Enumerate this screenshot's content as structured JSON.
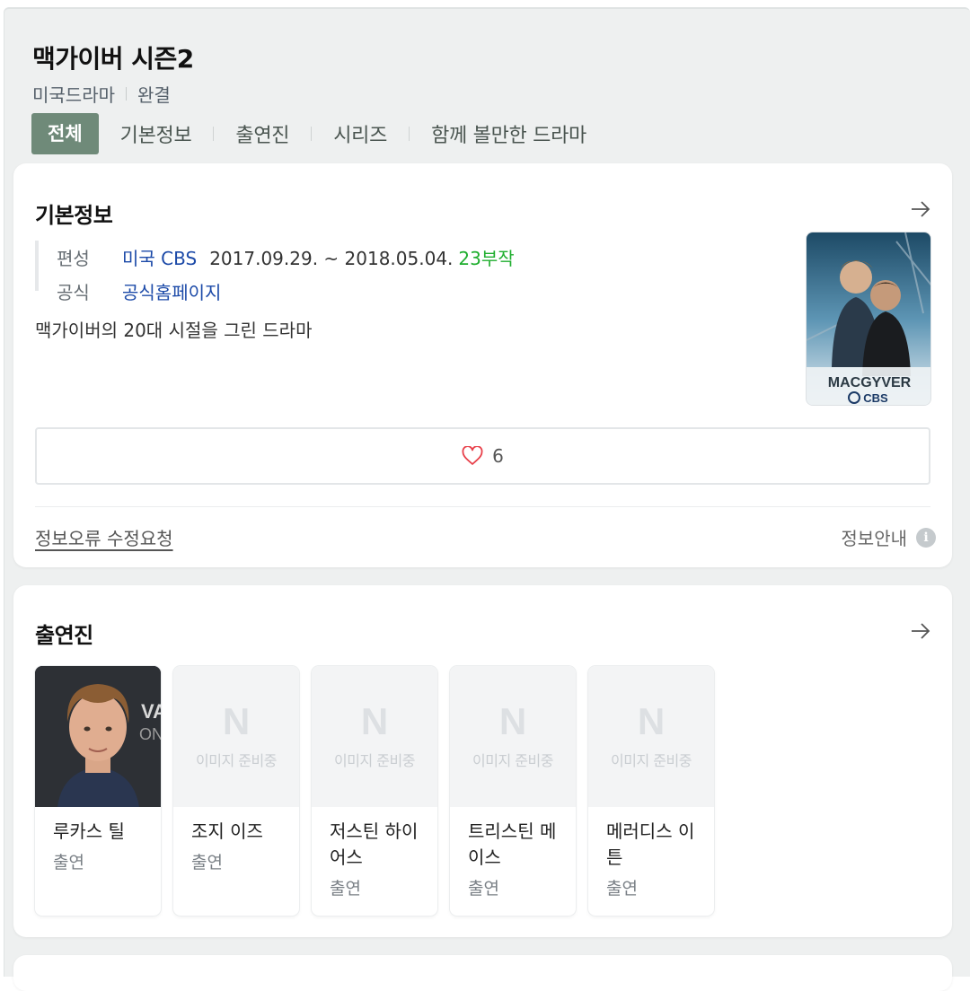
{
  "header": {
    "title": "맥가이버 시즌2",
    "genre": "미국드라마",
    "status": "완결",
    "tabs": [
      {
        "label": "전체",
        "active": true
      },
      {
        "label": "기본정보"
      },
      {
        "label": "출연진"
      },
      {
        "label": "시리즈"
      },
      {
        "label": "함께 볼만한 드라마"
      }
    ]
  },
  "basic_info": {
    "title": "기본정보",
    "broadcast_label": "편성",
    "broadcast_channel": "미국 CBS",
    "broadcast_period": "2017.09.29. ~ 2018.05.04.",
    "episodes": "23부작",
    "official_label": "공식",
    "official_link": "공식홈페이지",
    "description": "맥가이버의 20대 시절을 그린 드라마",
    "poster_title": "MACGYVER",
    "poster_network": "CBS",
    "like_count": "6",
    "report_link": "정보오류 수정요청",
    "info_guide": "정보안내",
    "info_icon_glyph": "i"
  },
  "cast": {
    "title": "출연진",
    "placeholder_logo": "N",
    "placeholder_text": "이미지 준비중",
    "members": [
      {
        "name": "루카스 틸",
        "role": "출연",
        "has_photo": true
      },
      {
        "name": "조지 이즈",
        "role": "출연",
        "has_photo": false
      },
      {
        "name": "저스틴 하이어스",
        "role": "출연",
        "has_photo": false
      },
      {
        "name": "트리스틴 메이스",
        "role": "출연",
        "has_photo": false
      },
      {
        "name": "메러디스 이튼",
        "role": "출연",
        "has_photo": false
      }
    ]
  },
  "colors": {
    "tab_active_bg": "#6f8a79",
    "link_blue": "#1c4aa8",
    "episode_green": "#1fae2e",
    "heart_red": "#e8404a"
  }
}
